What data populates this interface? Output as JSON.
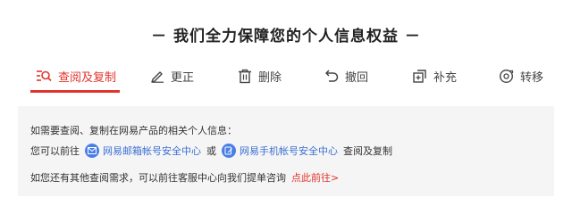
{
  "page": {
    "title": "－ 我们全力保障您的个人信息权益 －"
  },
  "tabs": [
    {
      "label": "查阅及复制",
      "icon": "search-list-icon",
      "active": true
    },
    {
      "label": "更正",
      "icon": "pencil-icon",
      "active": false
    },
    {
      "label": "删除",
      "icon": "trash-icon",
      "active": false
    },
    {
      "label": "撤回",
      "icon": "undo-icon",
      "active": false
    },
    {
      "label": "补充",
      "icon": "add-box-icon",
      "active": false
    },
    {
      "label": "转移",
      "icon": "transfer-icon",
      "active": false
    }
  ],
  "panel": {
    "intro": "如需要查阅、复制在网易产品的相关个人信息：",
    "prefix": "您可以前往",
    "link_mail": "网易邮箱帐号安全中心",
    "or": "或",
    "link_phone": "网易手机帐号安全中心",
    "suffix": "查阅及复制",
    "other_needs": "如您还有其他查阅需求，可以前往客服中心向我们提单咨询",
    "goto_link": "点此前往>"
  },
  "colors": {
    "accent": "#e2342d",
    "link": "#3b6fd4",
    "panel_bg": "#f5f5f5"
  }
}
